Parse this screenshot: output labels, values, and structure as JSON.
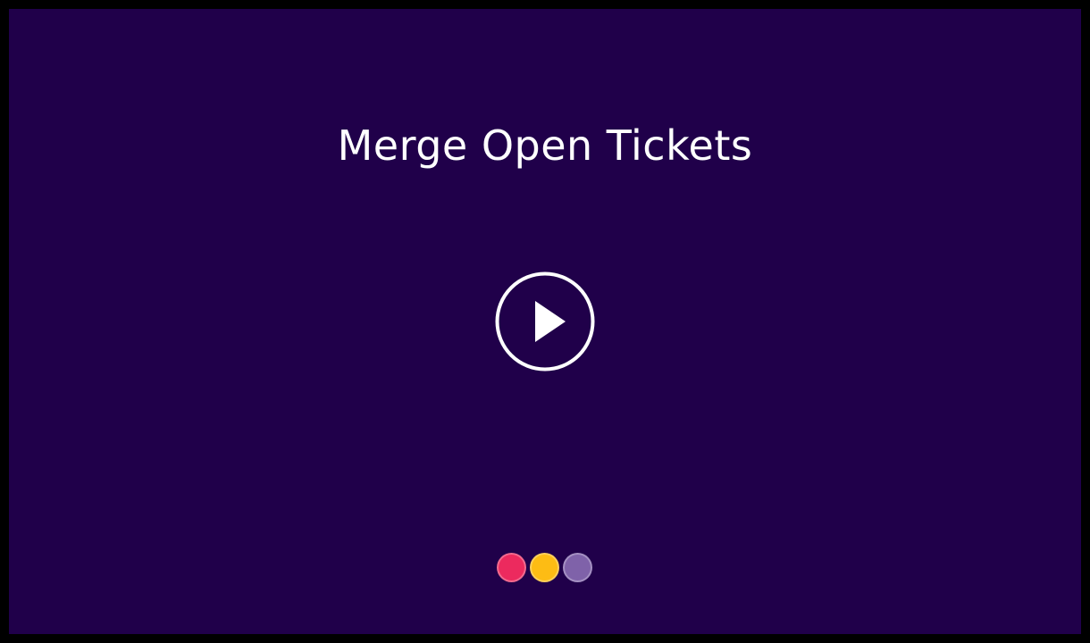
{
  "slide": {
    "title": "Merge Open Tickets",
    "background_color": "#20004a",
    "play_button_icon": "play-icon"
  },
  "dots": [
    {
      "name": "pink-dot",
      "color": "#ec2a5e"
    },
    {
      "name": "yellow-dot",
      "color": "#fdbc14"
    },
    {
      "name": "purple-dot",
      "color": "#7f62a9"
    }
  ]
}
